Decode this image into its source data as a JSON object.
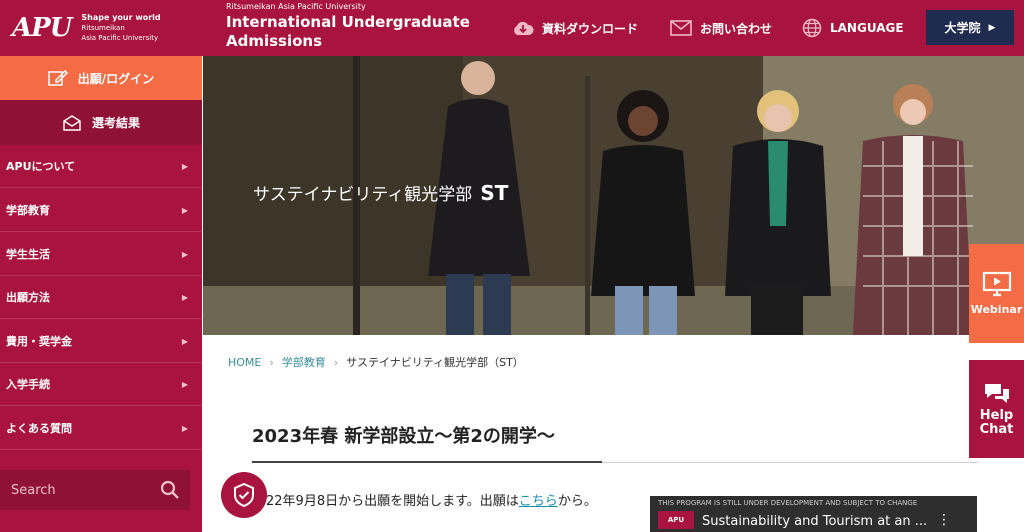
{
  "header": {
    "logo_mark": "APU",
    "logo_tagline": "Shape your world",
    "logo_sub1": "Ritsumeikan",
    "logo_sub2": "Asia Pacific University",
    "site_small": "Ritsumeikan Asia Pacific University",
    "site_title_line1": "International Undergraduate",
    "site_title_line2": "Admissions",
    "nav": [
      {
        "label": "資料ダウンロード",
        "icon": "cloud-download-icon"
      },
      {
        "label": "お問い合わせ",
        "icon": "mail-icon"
      },
      {
        "label": "LANGUAGE",
        "icon": "globe-icon"
      }
    ],
    "grad_button": "大学院"
  },
  "sidebar": {
    "apply_label": "出願/ログイン",
    "result_label": "選考結果",
    "items": [
      {
        "label": "APUについて"
      },
      {
        "label": "学部教育"
      },
      {
        "label": "学生生活"
      },
      {
        "label": "出願方法"
      },
      {
        "label": "費用・奨学金"
      },
      {
        "label": "入学手続"
      },
      {
        "label": "よくある質問"
      }
    ],
    "search_placeholder": "Search"
  },
  "hero": {
    "title": "サステイナビリティ観光学部",
    "title_code": "ST"
  },
  "breadcrumb": {
    "home": "HOME",
    "parent": "学部教育",
    "current": "サステイナビリティ観光学部（ST）"
  },
  "content": {
    "heading": "2023年春 新学部設立〜第2の開学〜",
    "body_prefix": "22年9月8日から出願を開始します。出願は",
    "body_link": "こちら",
    "body_suffix": "から。"
  },
  "video": {
    "notice": "THIS PROGRAM IS STILL UNDER DEVELOPMENT AND SUBJECT TO CHANGE",
    "logo": "APU",
    "title": "Sustainability and Tourism at an ..."
  },
  "floating": {
    "webinar_label": "Webinar",
    "help_label_1": "Help",
    "help_label_2": "Chat"
  }
}
